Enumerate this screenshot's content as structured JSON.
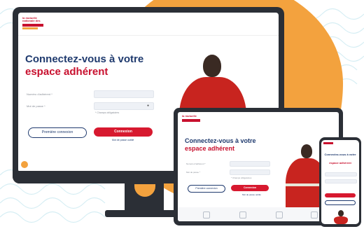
{
  "brand": {
    "logo_line1": "la mutuelle",
    "logo_line2": "nationale des",
    "logo_line3": "sapeurs-pompiers"
  },
  "login": {
    "heading_line1": "Connectez-vous à votre",
    "heading_line2": "espace adhérent",
    "member_number_label": "Numéro d'adhérent *",
    "password_label": "Mot de passe *",
    "forgot_hint": "* Champs obligatoires",
    "first_login_button": "Première connexion",
    "login_button": "Connexion",
    "forgot_password_link": "Mot de passe oublié"
  },
  "colors": {
    "accent_red": "#d7192f",
    "navy": "#1f3a6e",
    "orange": "#f3a23e",
    "device_frame": "#2b2f36"
  }
}
